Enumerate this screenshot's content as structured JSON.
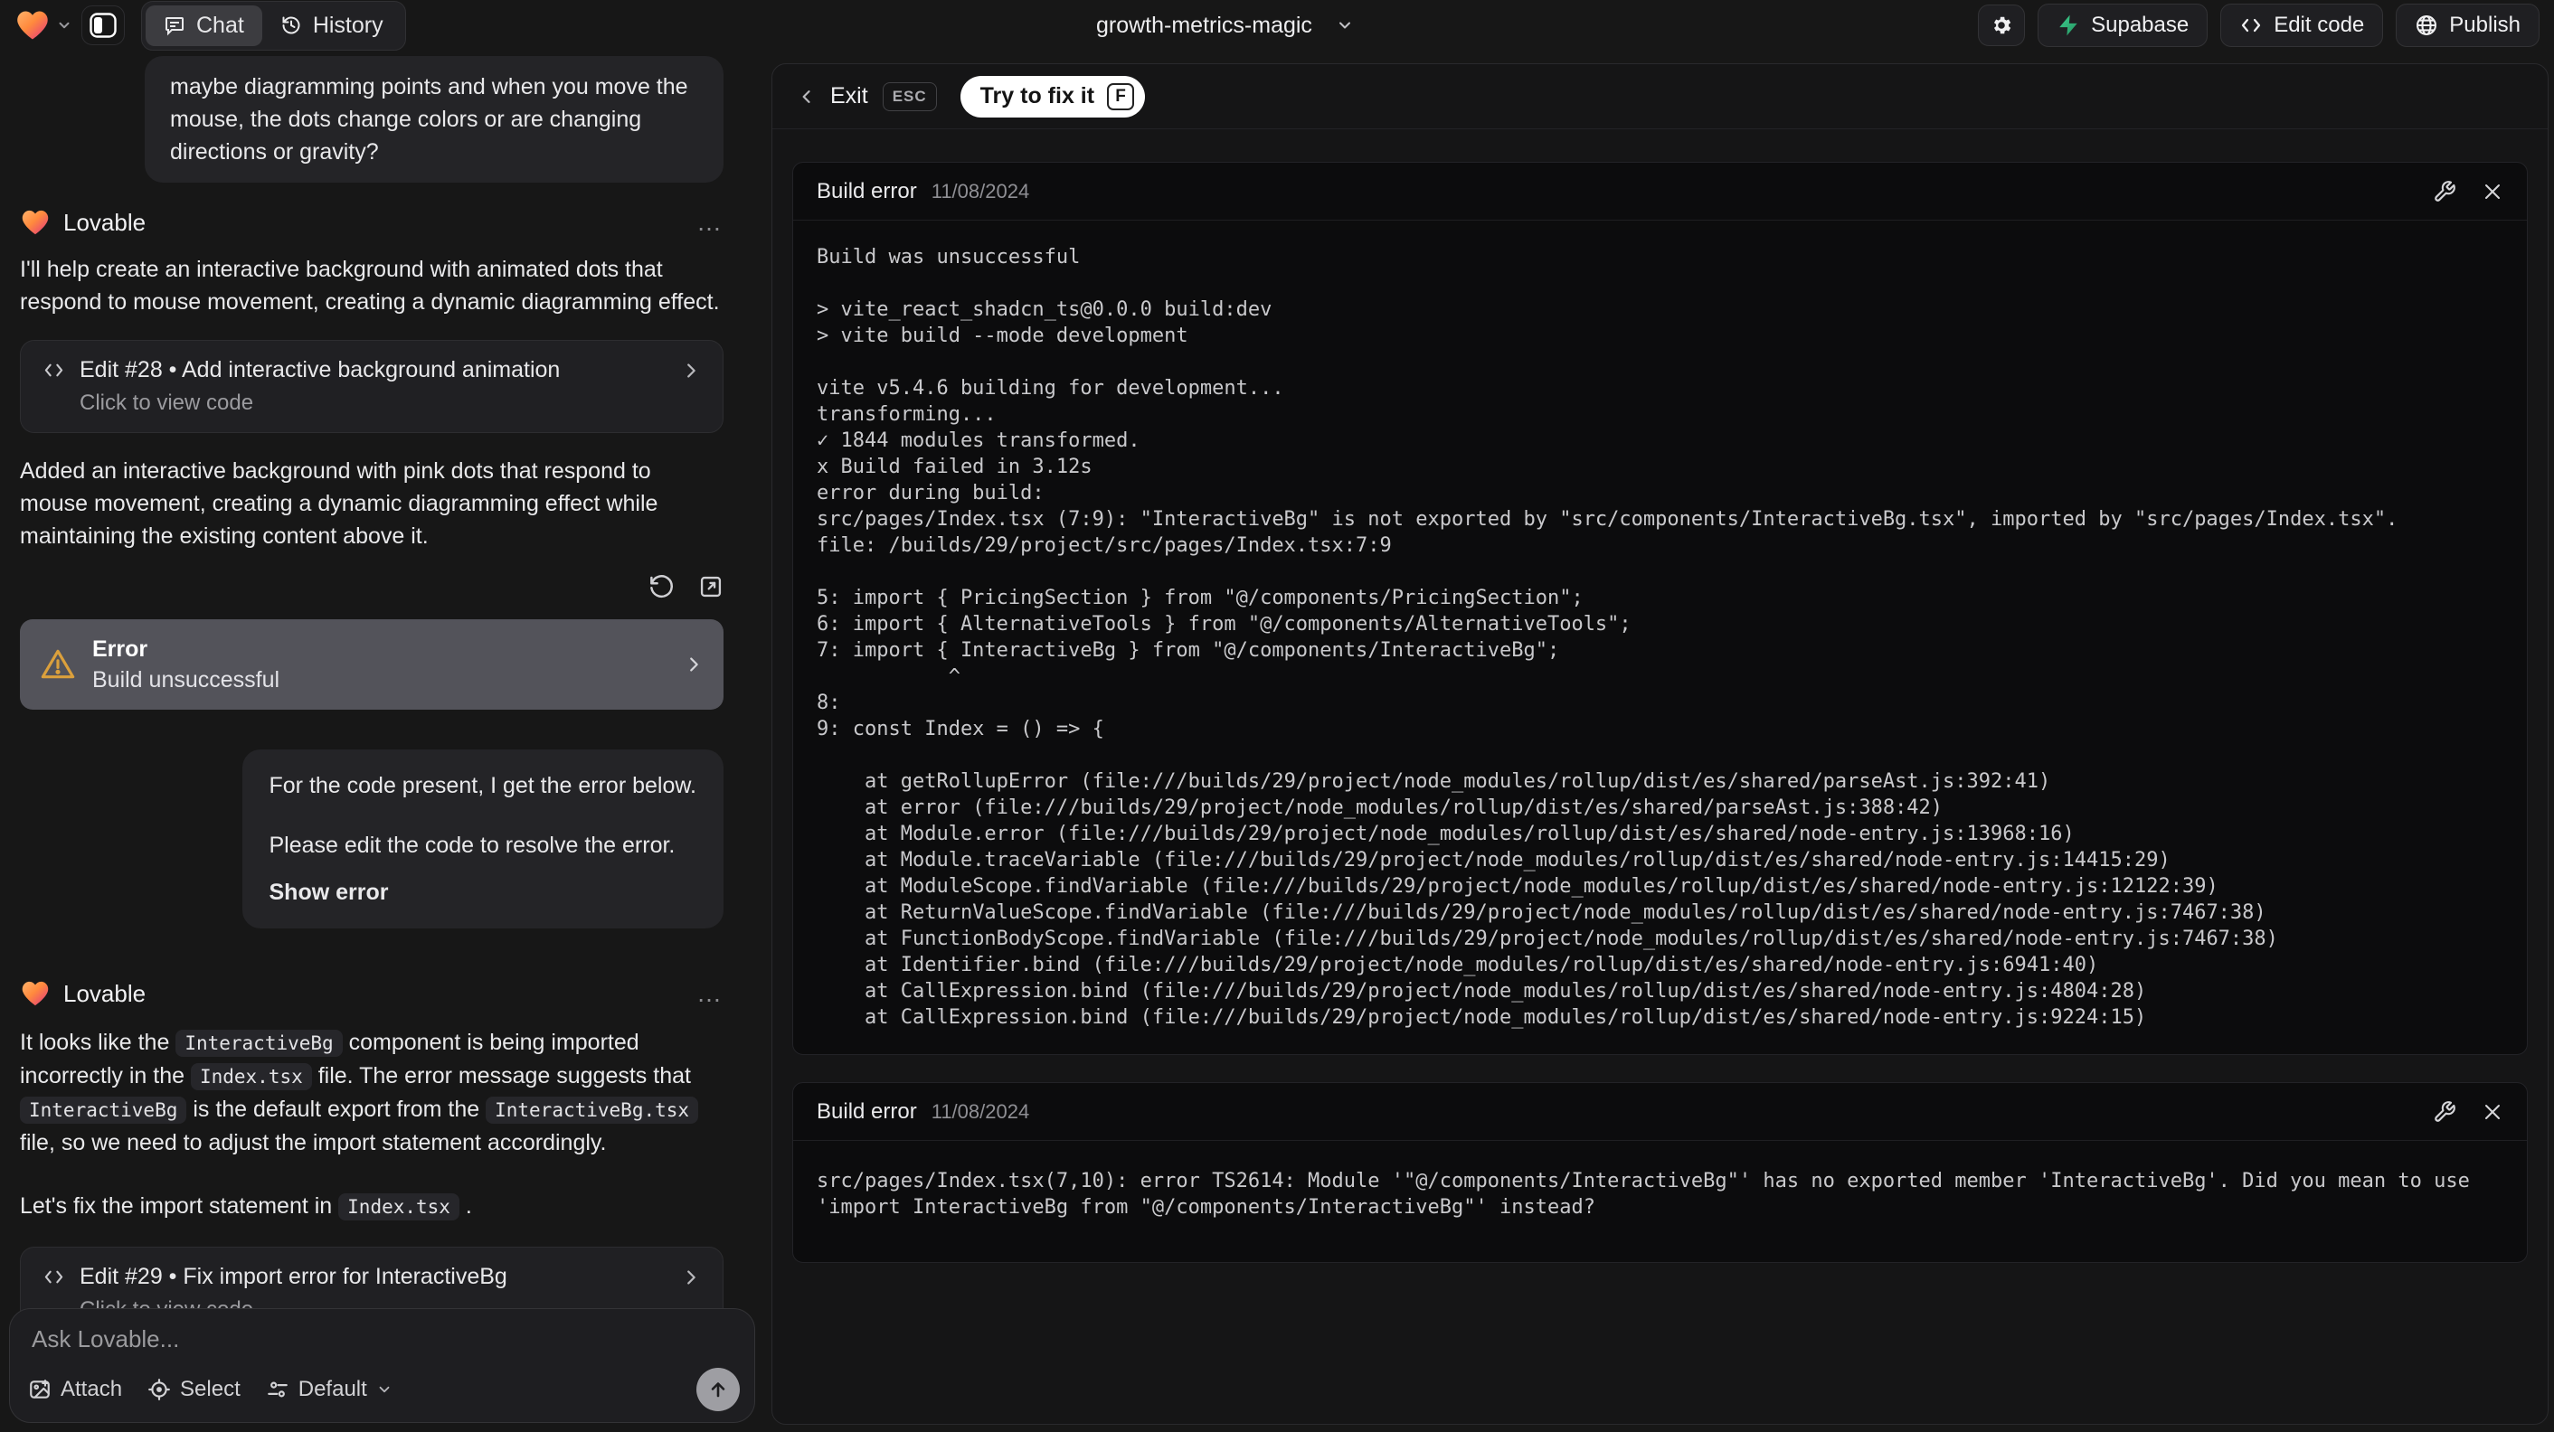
{
  "colors": {
    "supabase_green": "#3ecf8e",
    "warning_amber": "#d9a23c",
    "fix_button_bg": "#ffffff"
  },
  "topbar": {
    "project_name": "growth-metrics-magic",
    "tab_chat": "Chat",
    "tab_history": "History",
    "supabase": "Supabase",
    "edit_code": "Edit code",
    "publish": "Publish"
  },
  "chat": {
    "assistant_name": "Lovable",
    "menu_dots": "…",
    "user_message_1": "maybe diagramming points and when you move the mouse, the dots change colors or are changing directions or gravity?",
    "assistant_intro": "I'll help create an interactive background with animated dots that respond to mouse movement, creating a dynamic diagramming effect.",
    "edit_card_28": {
      "title": "Edit #28 • Add interactive background animation",
      "subtitle": "Click to view code"
    },
    "assistant_summary": "Added an interactive background with pink dots that respond to mouse movement, creating a dynamic diagramming effect while maintaining the existing content above it.",
    "error_card": {
      "title": "Error",
      "subtitle": "Build unsuccessful"
    },
    "user_message_2": {
      "line1": "For the code present, I get the error below.",
      "line2": "Please edit the code to resolve the error.",
      "action": "Show error"
    },
    "fix_message": [
      "It looks like the ",
      "InteractiveBg",
      " component is being imported incorrectly in the ",
      "Index.tsx",
      " file. The error message suggests that ",
      "InteractiveBg",
      " is the default export from the ",
      "InteractiveBg.tsx",
      " file, so we need to adjust the import statement accordingly."
    ],
    "fix_line": [
      "Let's fix the import statement in ",
      "Index.tsx",
      " ."
    ],
    "edit_card_29": {
      "title": "Edit #29 • Fix import error for InteractiveBg",
      "subtitle": "Click to view code"
    },
    "composer": {
      "placeholder": "Ask Lovable...",
      "attach": "Attach",
      "select": "Select",
      "model": "Default"
    }
  },
  "panel": {
    "exit_label": "Exit",
    "esc_key": "ESC",
    "fix_label": "Try to fix it",
    "fix_key": "F",
    "error_1": {
      "title": "Build error",
      "date": "11/08/2024",
      "log": "Build was unsuccessful\n\n> vite_react_shadcn_ts@0.0.0 build:dev\n> vite build --mode development\n\nvite v5.4.6 building for development...\ntransforming...\n✓ 1844 modules transformed.\nx Build failed in 3.12s\nerror during build:\nsrc/pages/Index.tsx (7:9): \"InteractiveBg\" is not exported by \"src/components/InteractiveBg.tsx\", imported by \"src/pages/Index.tsx\".\nfile: /builds/29/project/src/pages/Index.tsx:7:9\n\n5: import { PricingSection } from \"@/components/PricingSection\";\n6: import { AlternativeTools } from \"@/components/AlternativeTools\";\n7: import { InteractiveBg } from \"@/components/InteractiveBg\";\n           ^\n8: \n9: const Index = () => {\n\n    at getRollupError (file:///builds/29/project/node_modules/rollup/dist/es/shared/parseAst.js:392:41)\n    at error (file:///builds/29/project/node_modules/rollup/dist/es/shared/parseAst.js:388:42)\n    at Module.error (file:///builds/29/project/node_modules/rollup/dist/es/shared/node-entry.js:13968:16)\n    at Module.traceVariable (file:///builds/29/project/node_modules/rollup/dist/es/shared/node-entry.js:14415:29)\n    at ModuleScope.findVariable (file:///builds/29/project/node_modules/rollup/dist/es/shared/node-entry.js:12122:39)\n    at ReturnValueScope.findVariable (file:///builds/29/project/node_modules/rollup/dist/es/shared/node-entry.js:7467:38)\n    at FunctionBodyScope.findVariable (file:///builds/29/project/node_modules/rollup/dist/es/shared/node-entry.js:7467:38)\n    at Identifier.bind (file:///builds/29/project/node_modules/rollup/dist/es/shared/node-entry.js:6941:40)\n    at CallExpression.bind (file:///builds/29/project/node_modules/rollup/dist/es/shared/node-entry.js:4804:28)\n    at CallExpression.bind (file:///builds/29/project/node_modules/rollup/dist/es/shared/node-entry.js:9224:15)"
    },
    "error_2": {
      "title": "Build error",
      "date": "11/08/2024",
      "log": "src/pages/Index.tsx(7,10): error TS2614: Module '\"@/components/InteractiveBg\"' has no exported member 'InteractiveBg'. Did you mean to use 'import InteractiveBg from \"@/components/InteractiveBg\"' instead?"
    }
  }
}
